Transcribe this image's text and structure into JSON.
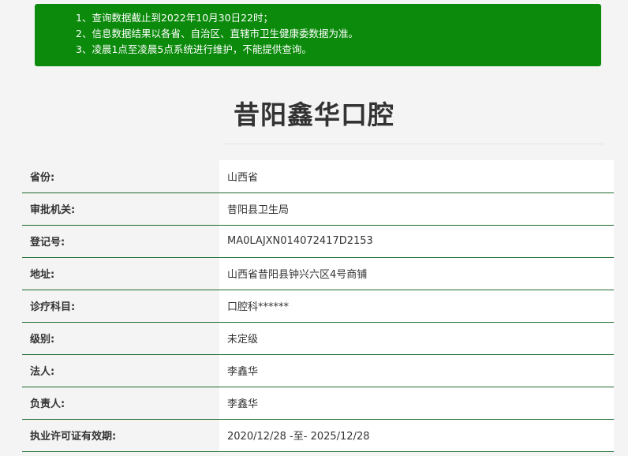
{
  "notice": {
    "lines": [
      "1、查询数据截止到2022年10月30日22时；",
      "2、信息数据结果以各省、自治区、直辖市卫生健康委数据为准。",
      "3、凌晨1点至凌晨5点系统进行维护，不能提供查询。"
    ]
  },
  "title": "昔阳鑫华口腔",
  "rows": [
    {
      "label": "省份:",
      "value": "山西省"
    },
    {
      "label": "审批机关:",
      "value": "昔阳县卫生局"
    },
    {
      "label": "登记号:",
      "value": "MA0LAJXN014072417D2153"
    },
    {
      "label": "地址:",
      "value": "山西省昔阳县钟兴六区4号商铺"
    },
    {
      "label": "诊疗科目:",
      "value": "口腔科******"
    },
    {
      "label": "级别:",
      "value": "未定级"
    },
    {
      "label": "法人:",
      "value": "李鑫华"
    },
    {
      "label": "负责人:",
      "value": "李鑫华"
    },
    {
      "label": "执业许可证有效期:",
      "value": "2020/12/28 -至- 2025/12/28"
    }
  ]
}
